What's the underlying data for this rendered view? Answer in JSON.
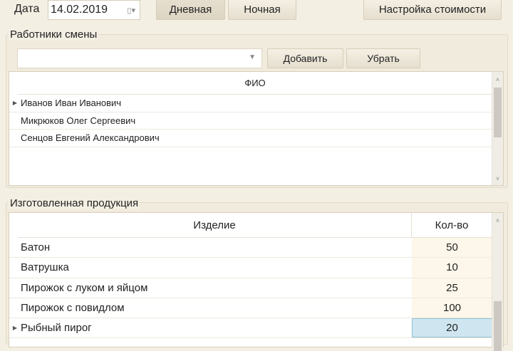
{
  "toolbar": {
    "date_label": "Дата",
    "date_value": "14.02.2019",
    "day_shift": "Дневная",
    "night_shift": "Ночная",
    "cost_settings": "Настройка стоимости"
  },
  "workers": {
    "title": "Работники смены",
    "combo_value": "",
    "add": "Добавить",
    "remove": "Убрать",
    "column": "ФИО",
    "rows": [
      "Иванов Иван Иванович",
      "Микрюков Олег Сергеевич",
      "Сенцов Евгений Александрович"
    ]
  },
  "products": {
    "title": "Изготовленная продукция",
    "col_item": "Изделие",
    "col_qty": "Кол-во",
    "rows": [
      {
        "item": "Батон",
        "qty": "50"
      },
      {
        "item": "Ватрушка",
        "qty": "10"
      },
      {
        "item": "Пирожок с луком и яйцом",
        "qty": "25"
      },
      {
        "item": "Пирожок с повидлом",
        "qty": "100"
      },
      {
        "item": "Рыбный пирог",
        "qty": "20"
      }
    ]
  },
  "colors": {
    "selected_cell": "#cfe6f0",
    "qty_bg": "#fdf6ea"
  }
}
